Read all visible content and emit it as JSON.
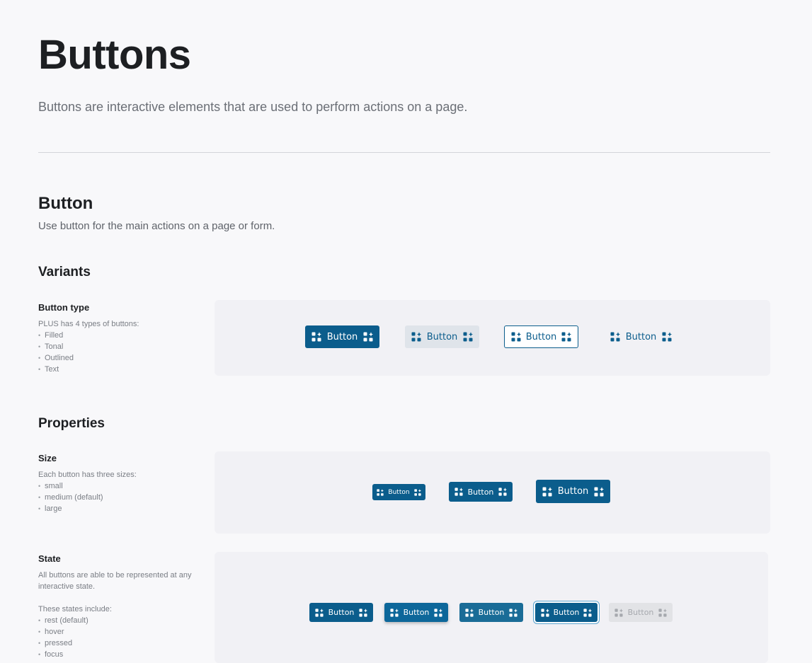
{
  "page": {
    "title": "Buttons",
    "description": "Buttons are interactive elements that are used to perform actions on a page."
  },
  "section": {
    "title": "Button",
    "description": "Use button for the main actions on a page or form."
  },
  "variants": {
    "heading": "Variants",
    "button_type": {
      "label": "Button type",
      "text": "PLUS has 4 types of buttons:",
      "items": [
        "Filled",
        "Tonal",
        "Outlined",
        "Text"
      ]
    },
    "buttons": [
      {
        "label": "Button",
        "variant": "filled"
      },
      {
        "label": "Button",
        "variant": "tonal"
      },
      {
        "label": "Button",
        "variant": "outlined"
      },
      {
        "label": "Button",
        "variant": "text"
      }
    ]
  },
  "properties": {
    "heading": "Properties",
    "size": {
      "label": "Size",
      "text": "Each button has three sizes:",
      "items": [
        "small",
        "medium (default)",
        "large"
      ],
      "buttons": [
        {
          "label": "Button",
          "size": "small"
        },
        {
          "label": "Button",
          "size": "medium"
        },
        {
          "label": "Button",
          "size": "large"
        }
      ]
    },
    "state": {
      "label": "State",
      "text": "All buttons are able to be represented at any interactive state.",
      "text2": "These states include:",
      "items": [
        "rest (default)",
        "hover",
        "pressed",
        "focus"
      ],
      "buttons": [
        {
          "label": "Button",
          "state": "rest"
        },
        {
          "label": "Button",
          "state": "hover"
        },
        {
          "label": "Button",
          "state": "pressed"
        },
        {
          "label": "Button",
          "state": "focus"
        },
        {
          "label": "Button",
          "state": "disabled"
        }
      ]
    }
  },
  "icons": {
    "leading": "sparkle-grid-icon",
    "trailing": "sparkle-grid-icon"
  },
  "colors": {
    "primary": "#0b5d8c",
    "tonal_bg": "#dfe4ea",
    "disabled_bg": "#e2e3e6"
  }
}
